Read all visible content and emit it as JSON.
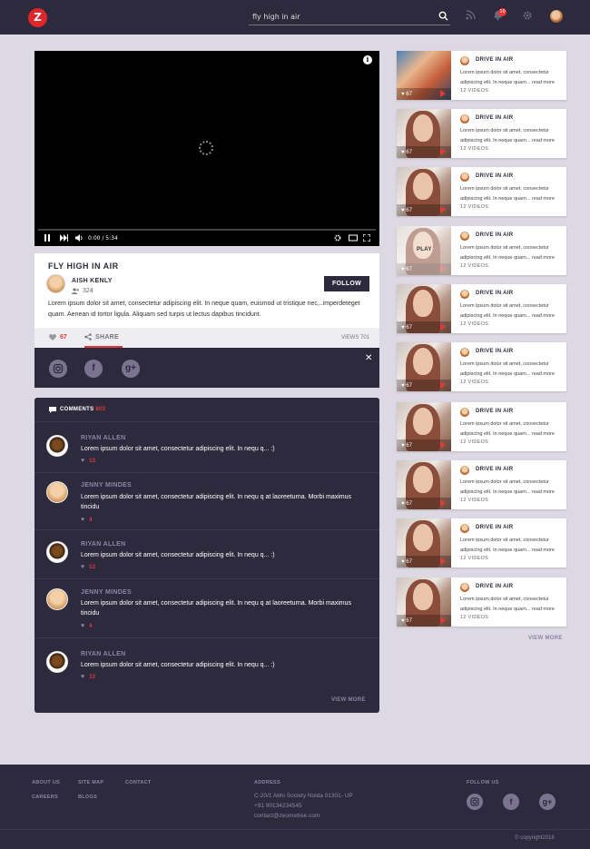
{
  "header": {
    "logo": "Z",
    "search_value": "fly high in air",
    "notif_count": "10"
  },
  "video": {
    "time": "0:00 / 5:34"
  },
  "details": {
    "title": "FLY HIGH IN AIR",
    "author": "AISH KENLY",
    "author_count": "324",
    "follow_label": "FOLLOW",
    "description": "Lorem ipsum dolor sit amet, consectetur adipiscing elit. In neque quam, euismod ut tristique nec,..imperdeteget quam. Aenean id tortor ligula. Aliquam sed turpis ut lectus dapibus tincidunt.",
    "likes": "67",
    "share_label": "SHARE",
    "views": "VIEWS 701"
  },
  "comments": {
    "header_label": "COMMENTS",
    "header_count": "803",
    "view_more": "VIEW MORE",
    "items": [
      {
        "name": "RIYAN ALLEN",
        "text": "Lorem ipsum dolor sit amet, consectetur adipiscing elit. In nequ q... :)",
        "likes": "13"
      },
      {
        "name": "JENNY MINDES",
        "text": "Lorem ipsum dolor sit amet, consectetur adipiscing elit. In nequ q at laoreeturna. Morbi maximus tincidu",
        "likes": "4"
      },
      {
        "name": "RIYAN ALLEN",
        "text": "Lorem ipsum dolor sit amet, consectetur adipiscing elit. In nequ q... :)",
        "likes": "13"
      },
      {
        "name": "JENNY MINDES",
        "text": "Lorem ipsum dolor sit amet, consectetur adipiscing elit. In nequ q at laoreeturna. Morbi maximus tincidu",
        "likes": "4"
      },
      {
        "name": "RIYAN ALLEN",
        "text": "Lorem ipsum dolor sit amet, consectetur adipiscing elit. In nequ q... :)",
        "likes": "13"
      }
    ]
  },
  "sidebar": {
    "view_more": "VIEW MORE",
    "play_label": "PLAY",
    "items": [
      {
        "title": "DRIVE IN AIR",
        "desc": "Lorem ipsum dolor sit amet, consectetur adipiscing elit. In neque quam... read more",
        "count": "12 VIDEOS",
        "likes": "67"
      },
      {
        "title": "DRIVE IN AIR",
        "desc": "Lorem ipsum dolor sit amet, consectetur adipiscing elit. In neque quam... read more",
        "count": "12 VIDEOS",
        "likes": "67"
      },
      {
        "title": "DRIVE IN AIR",
        "desc": "Lorem ipsum dolor sit amet, consectetur adipiscing elit. In neque quam... read more",
        "count": "12 VIDEOS",
        "likes": "67"
      },
      {
        "title": "DRIVE IN AIR",
        "desc": "Lorem ipsum dolor sit amet, consectetur adipiscing elit. In neque quam... read more",
        "count": "12 VIDEOS",
        "likes": "67"
      },
      {
        "title": "DRIVE IN AIR",
        "desc": "Lorem ipsum dolor sit amet, consectetur adipiscing elit. In neque quam... read more",
        "count": "12 VIDEOS",
        "likes": "67"
      },
      {
        "title": "DRIVE IN AIR",
        "desc": "Lorem ipsum dolor sit amet, consectetur adipiscing elit. In neque quam... read more",
        "count": "12 VIDEOS",
        "likes": "67"
      },
      {
        "title": "DRIVE IN AIR",
        "desc": "Lorem ipsum dolor sit amet, consectetur adipiscing elit. In neque quam... read more",
        "count": "12 VIDEOS",
        "likes": "67"
      },
      {
        "title": "DRIVE IN AIR",
        "desc": "Lorem ipsum dolor sit amet, consectetur adipiscing elit. In neque quam... read more",
        "count": "12 VIDEOS",
        "likes": "67"
      },
      {
        "title": "DRIVE IN AIR",
        "desc": "Lorem ipsum dolor sit amet, consectetur adipiscing elit. In neque quam... read more",
        "count": "12 VIDEOS",
        "likes": "67"
      },
      {
        "title": "DRIVE IN AIR",
        "desc": "Lorem ipsum dolor sit amet, consectetur adipiscing elit. In neque quam... read more",
        "count": "12 VIDEOS",
        "likes": "67"
      }
    ]
  },
  "footer": {
    "links": [
      "ABOUT US",
      "SITE MAP",
      "CONTACT",
      "CAREERS",
      "BLOGS"
    ],
    "address_label": "ADDRESS",
    "address_line1": "C-20/1 Abhi Society Noida 01301- UP",
    "phone": "+91 90134234545",
    "email": "contact@zeometree.com",
    "follow_label": "FOLLOW US",
    "copyright": "copyright2016"
  },
  "colors": {
    "dark": "#2e2a3d",
    "accent": "#e03a3a",
    "muted": "#8c85a8",
    "page_bg": "#dcd9e4"
  }
}
